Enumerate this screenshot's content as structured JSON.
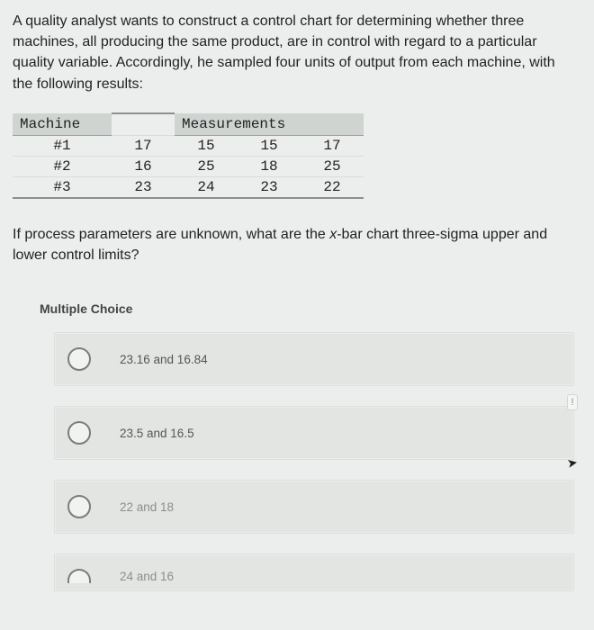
{
  "question": {
    "intro": "A quality analyst wants to construct a control chart for determining whether three machines, all producing the same product, are in control with regard to a particular quality variable. Accordingly, he sampled four units of output from each machine, with the following results:",
    "followup_pre": "If process parameters are unknown, what are the ",
    "followup_var": "x",
    "followup_post": "-bar chart three-sigma upper and lower control limits?"
  },
  "table": {
    "header_machine": "Machine",
    "header_measurements": "Measurements",
    "rows": [
      {
        "label": "#1",
        "m1": "17",
        "m2": "15",
        "m3": "15",
        "m4": "17"
      },
      {
        "label": "#2",
        "m1": "16",
        "m2": "25",
        "m3": "18",
        "m4": "25"
      },
      {
        "label": "#3",
        "m1": "23",
        "m2": "24",
        "m3": "23",
        "m4": "22"
      }
    ]
  },
  "mc": {
    "label": "Multiple Choice",
    "options": [
      "23.16 and 16.84",
      "23.5 and 16.5",
      "22 and 18",
      "24 and 16"
    ]
  },
  "hint_icon": "!"
}
